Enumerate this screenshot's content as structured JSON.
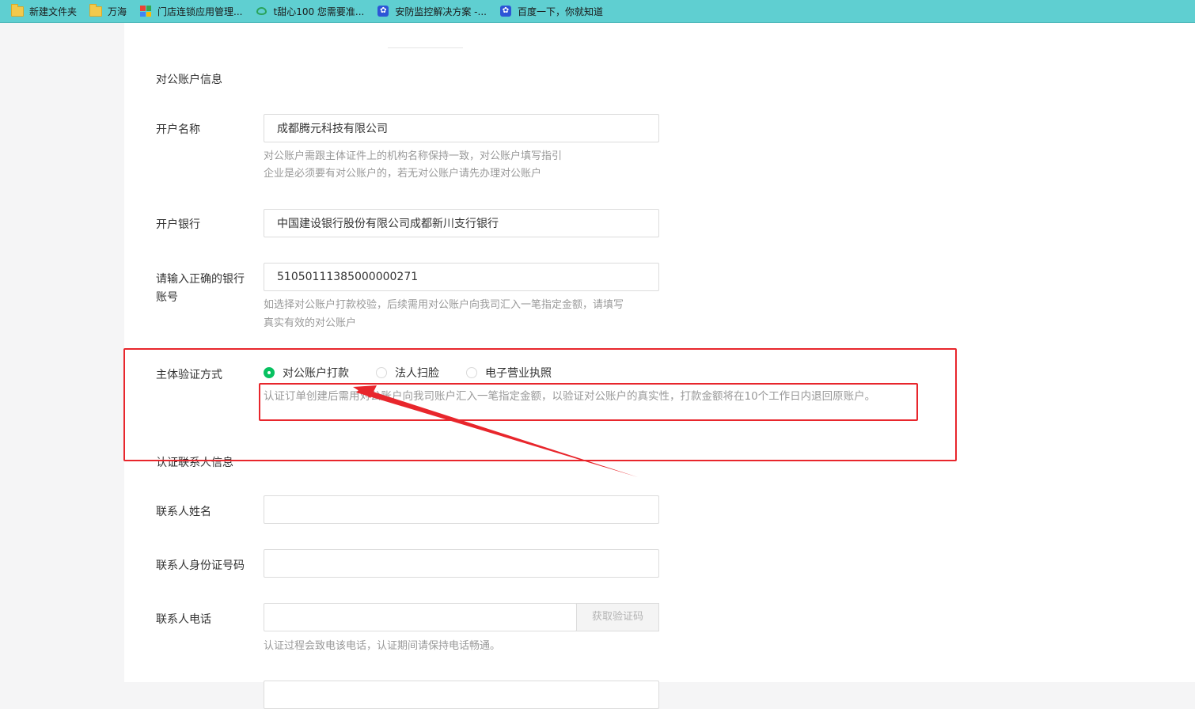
{
  "bookmarks": [
    {
      "label": "新建文件夹",
      "icon": "folder-icon"
    },
    {
      "label": "万海",
      "icon": "folder-icon"
    },
    {
      "label": "门店连锁应用管理...",
      "icon": "app-tiles-icon"
    },
    {
      "label": "t甜心100 您需要准...",
      "icon": "leaf-icon"
    },
    {
      "label": "安防监控解决方案 -...",
      "icon": "baidu-paw-icon"
    },
    {
      "label": "百度一下，你就知道",
      "icon": "baidu-paw-icon"
    }
  ],
  "account_section": {
    "title": "对公账户信息",
    "account_name": {
      "label": "开户名称",
      "value": "成都腾元科技有限公司",
      "hint_line1": "对公账户需跟主体证件上的机构名称保持一致，对公账户填写指引",
      "hint_line2": "企业是必须要有对公账户的，若无对公账户请先办理对公账户"
    },
    "bank": {
      "label": "开户银行",
      "value": "中国建设银行股份有限公司成都新川支行银行"
    },
    "account_number": {
      "label_line1": "请输入正确的银行",
      "label_line2": "账号",
      "value": "51050111385000000271",
      "hint_line1": "如选择对公账户打款校验，后续需用对公账户向我司汇入一笔指定金额，请填写",
      "hint_line2": "真实有效的对公账户"
    },
    "verification": {
      "label": "主体验证方式",
      "options": [
        "对公账户打款",
        "法人扫脸",
        "电子营业执照"
      ],
      "selected": "对公账户打款",
      "hint": "认证订单创建后需用对公账户向我司账户汇入一笔指定金额，以验证对公账户的真实性，打款金额将在10个工作日内退回原账户。"
    }
  },
  "contact_section": {
    "title": "认证联系人信息",
    "name": {
      "label": "联系人姓名",
      "value": ""
    },
    "id_number": {
      "label": "联系人身份证号码",
      "value": ""
    },
    "phone": {
      "label": "联系人电话",
      "value": "",
      "code_button": "获取验证码",
      "hint": "认证过程会致电该电话，认证期间请保持电话畅通。"
    }
  },
  "colors": {
    "bookmark_bar": "#5fcfd1",
    "accent_green": "#07c160",
    "annotation_red": "#e8262c"
  }
}
